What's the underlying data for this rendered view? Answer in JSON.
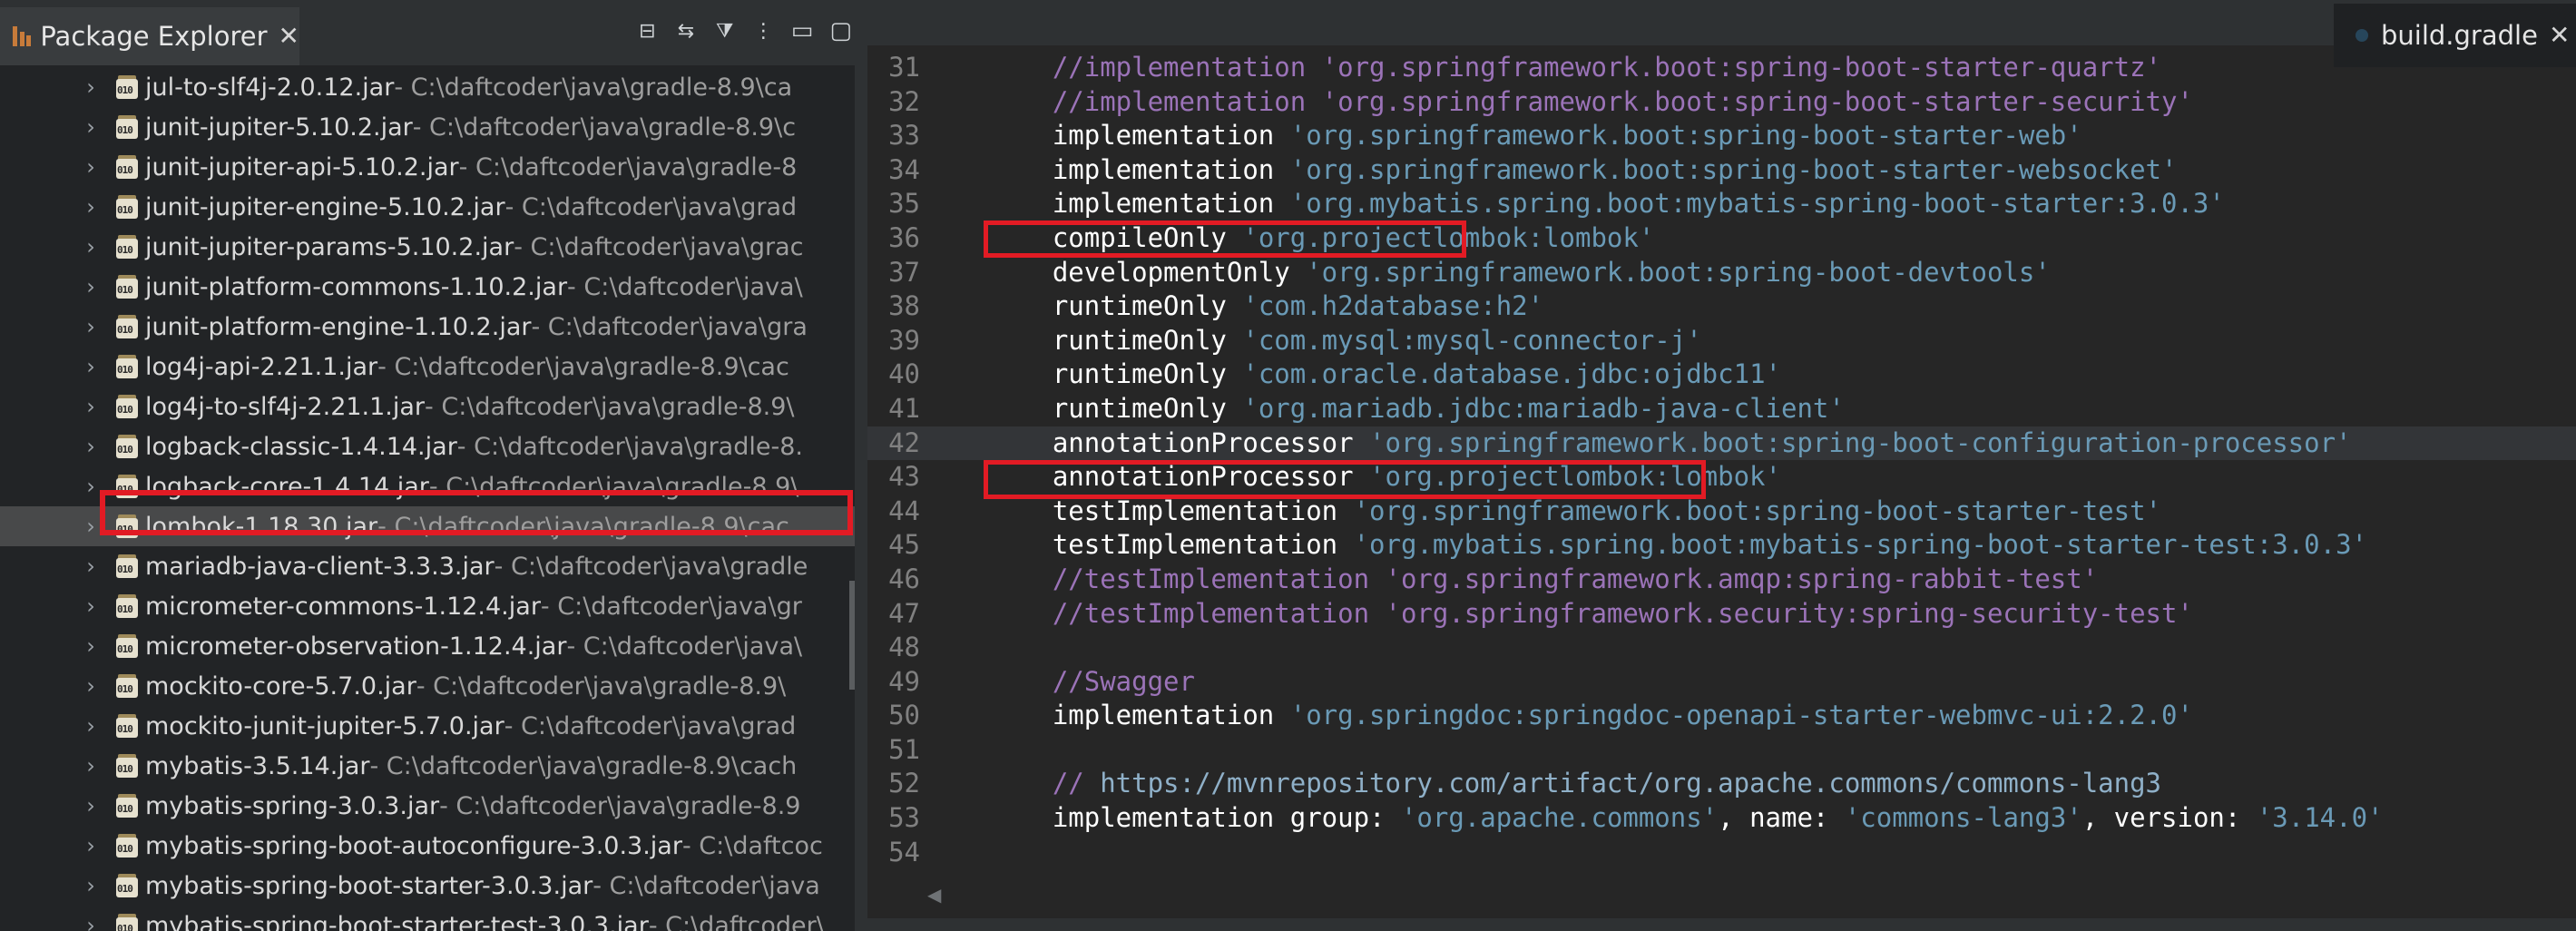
{
  "explorer": {
    "title": "Package Explorer",
    "close_glyph": "✕",
    "toolbar_icons": [
      "collapse-all-icon",
      "link-with-editor-icon",
      "filters-icon",
      "view-menu-icon",
      "minimize-icon",
      "maximize-icon"
    ],
    "rows": [
      {
        "name": "jul-to-slf4j-2.0.12.jar",
        "path": " - C:\\daftcoder\\java\\gradle-8.9\\ca",
        "selected": false
      },
      {
        "name": "junit-jupiter-5.10.2.jar",
        "path": " - C:\\daftcoder\\java\\gradle-8.9\\c",
        "selected": false
      },
      {
        "name": "junit-jupiter-api-5.10.2.jar",
        "path": " - C:\\daftcoder\\java\\gradle-8",
        "selected": false
      },
      {
        "name": "junit-jupiter-engine-5.10.2.jar",
        "path": " - C:\\daftcoder\\java\\grad",
        "selected": false
      },
      {
        "name": "junit-jupiter-params-5.10.2.jar",
        "path": " - C:\\daftcoder\\java\\grac",
        "selected": false
      },
      {
        "name": "junit-platform-commons-1.10.2.jar",
        "path": " - C:\\daftcoder\\java\\",
        "selected": false
      },
      {
        "name": "junit-platform-engine-1.10.2.jar",
        "path": " - C:\\daftcoder\\java\\gra",
        "selected": false
      },
      {
        "name": "log4j-api-2.21.1.jar",
        "path": " - C:\\daftcoder\\java\\gradle-8.9\\cac",
        "selected": false
      },
      {
        "name": "log4j-to-slf4j-2.21.1.jar",
        "path": " - C:\\daftcoder\\java\\gradle-8.9\\",
        "selected": false
      },
      {
        "name": "logback-classic-1.4.14.jar",
        "path": " - C:\\daftcoder\\java\\gradle-8.",
        "selected": false
      },
      {
        "name": "logback-core-1.4.14.jar",
        "path": " - C:\\daftcoder\\java\\gradle-8.9\\",
        "selected": false
      },
      {
        "name": "lombok-1.18.30.jar",
        "path": " - C:\\daftcoder\\java\\gradle-8.9\\cac",
        "selected": true
      },
      {
        "name": "mariadb-java-client-3.3.3.jar",
        "path": " - C:\\daftcoder\\java\\gradle",
        "selected": false
      },
      {
        "name": "micrometer-commons-1.12.4.jar",
        "path": " - C:\\daftcoder\\java\\gr",
        "selected": false
      },
      {
        "name": "micrometer-observation-1.12.4.jar",
        "path": " - C:\\daftcoder\\java\\",
        "selected": false
      },
      {
        "name": "mockito-core-5.7.0.jar",
        "path": " - C:\\daftcoder\\java\\gradle-8.9\\",
        "selected": false
      },
      {
        "name": "mockito-junit-jupiter-5.7.0.jar",
        "path": " - C:\\daftcoder\\java\\grad",
        "selected": false
      },
      {
        "name": "mybatis-3.5.14.jar",
        "path": " - C:\\daftcoder\\java\\gradle-8.9\\cach",
        "selected": false
      },
      {
        "name": "mybatis-spring-3.0.3.jar",
        "path": " - C:\\daftcoder\\java\\gradle-8.9",
        "selected": false
      },
      {
        "name": "mybatis-spring-boot-autoconfigure-3.0.3.jar",
        "path": " - C:\\daftcoc",
        "selected": false
      },
      {
        "name": "mybatis-spring-boot-starter-3.0.3.jar",
        "path": " - C:\\daftcoder\\java",
        "selected": false
      },
      {
        "name": "mybatis-spring-boot-starter-test-3.0.3.jar",
        "path": " - C:\\daftcoder\\",
        "selected": false
      }
    ]
  },
  "editor": {
    "tab_label": "build.gradle",
    "close_glyph": "✕",
    "lines": [
      {
        "n": "31",
        "tokens": [
          {
            "t": "    //implementation 'org.springframework.boot:spring-boot-starter-quartz'",
            "c": "cmt"
          }
        ]
      },
      {
        "n": "32",
        "tokens": [
          {
            "t": "    //implementation 'org.springframework.boot:spring-boot-starter-security'",
            "c": "cmt"
          }
        ]
      },
      {
        "n": "33",
        "tokens": [
          {
            "t": "    implementation ",
            "c": "kw"
          },
          {
            "t": "'org.springframework.boot:spring-boot-starter-web'",
            "c": "str"
          }
        ]
      },
      {
        "n": "34",
        "tokens": [
          {
            "t": "    implementation ",
            "c": "kw"
          },
          {
            "t": "'org.springframework.boot:spring-boot-starter-websocket'",
            "c": "str"
          }
        ]
      },
      {
        "n": "35",
        "tokens": [
          {
            "t": "    implementation ",
            "c": "kw"
          },
          {
            "t": "'org.mybatis.spring.boot:mybatis-spring-boot-starter:3.0.3'",
            "c": "str"
          }
        ]
      },
      {
        "n": "36",
        "tokens": [
          {
            "t": "    compileOnly ",
            "c": "kw"
          },
          {
            "t": "'org.projectlombok:lombok'",
            "c": "str"
          }
        ]
      },
      {
        "n": "37",
        "tokens": [
          {
            "t": "    developmentOnly ",
            "c": "kw"
          },
          {
            "t": "'org.springframework.boot:spring-boot-devtools'",
            "c": "str"
          }
        ]
      },
      {
        "n": "38",
        "tokens": [
          {
            "t": "    runtimeOnly ",
            "c": "kw"
          },
          {
            "t": "'com.h2database:h2'",
            "c": "str"
          }
        ]
      },
      {
        "n": "39",
        "tokens": [
          {
            "t": "    runtimeOnly ",
            "c": "kw"
          },
          {
            "t": "'com.mysql:mysql-connector-j'",
            "c": "str"
          }
        ]
      },
      {
        "n": "40",
        "tokens": [
          {
            "t": "    runtimeOnly ",
            "c": "kw"
          },
          {
            "t": "'com.oracle.database.jdbc:ojdbc11'",
            "c": "str"
          }
        ]
      },
      {
        "n": "41",
        "tokens": [
          {
            "t": "    runtimeOnly ",
            "c": "kw"
          },
          {
            "t": "'org.mariadb.jdbc:mariadb-java-client'",
            "c": "str"
          }
        ]
      },
      {
        "n": "42",
        "current": true,
        "tokens": [
          {
            "t": "    annotationProcessor ",
            "c": "kw"
          },
          {
            "t": "'org.springframework.boot:spring-boot-configuration-processor'",
            "c": "str"
          }
        ]
      },
      {
        "n": "43",
        "tokens": [
          {
            "t": "    annotationProcessor ",
            "c": "kw"
          },
          {
            "t": "'org.projectlombok:lombok'",
            "c": "str"
          }
        ]
      },
      {
        "n": "44",
        "tokens": [
          {
            "t": "    testImplementation ",
            "c": "kw"
          },
          {
            "t": "'org.springframework.boot:spring-boot-starter-test'",
            "c": "str"
          }
        ]
      },
      {
        "n": "45",
        "tokens": [
          {
            "t": "    testImplementation ",
            "c": "kw"
          },
          {
            "t": "'org.mybatis.spring.boot:mybatis-spring-boot-starter-test:3.0.3'",
            "c": "str"
          }
        ]
      },
      {
        "n": "46",
        "tokens": [
          {
            "t": "    //testImplementation 'org.springframework.amqp:spring-rabbit-test'",
            "c": "cmt"
          }
        ]
      },
      {
        "n": "47",
        "tokens": [
          {
            "t": "    //testImplementation 'org.springframework.security:spring-security-test'",
            "c": "cmt"
          }
        ]
      },
      {
        "n": "48",
        "tokens": []
      },
      {
        "n": "49",
        "tokens": [
          {
            "t": "    //Swagger",
            "c": "cmt"
          }
        ]
      },
      {
        "n": "50",
        "tokens": [
          {
            "t": "    implementation ",
            "c": "kw"
          },
          {
            "t": "'org.springdoc:springdoc-openapi-starter-webmvc-ui:2.2.0'",
            "c": "str"
          }
        ]
      },
      {
        "n": "51",
        "tokens": []
      },
      {
        "n": "52",
        "tokens": [
          {
            "t": "    // ",
            "c": "cmt"
          },
          {
            "t": "https://mvnrepository.com/artifact/org.apache.commons/commons-lang3",
            "c": "url"
          }
        ]
      },
      {
        "n": "53",
        "tokens": [
          {
            "t": "    implementation group: ",
            "c": "kw"
          },
          {
            "t": "'org.apache.commons'",
            "c": "str"
          },
          {
            "t": ", name: ",
            "c": "kw"
          },
          {
            "t": "'commons-lang3'",
            "c": "str"
          },
          {
            "t": ", version: ",
            "c": "kw"
          },
          {
            "t": "'3.14.0'",
            "c": "str"
          }
        ]
      },
      {
        "n": "54",
        "tokens": []
      }
    ]
  }
}
